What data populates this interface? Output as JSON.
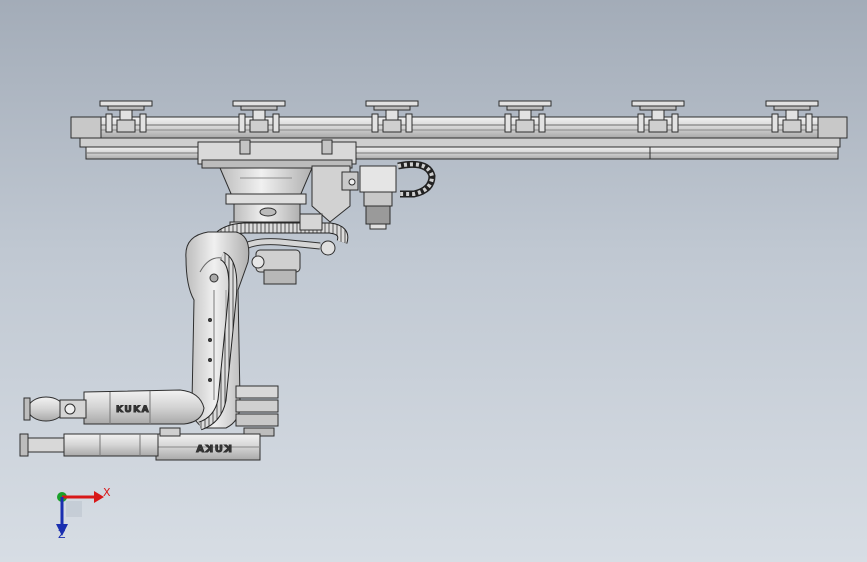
{
  "viewport": {
    "background_top": "#a3acb8",
    "background_bottom": "#d7dde4"
  },
  "model": {
    "brand_upper": "KUKA",
    "brand_lower": "KUKA"
  },
  "triad": {
    "x_label": "X",
    "z_label": "Z",
    "x_color": "#d81818",
    "y_color": "#1aa02a",
    "z_color": "#1a2fb0"
  }
}
